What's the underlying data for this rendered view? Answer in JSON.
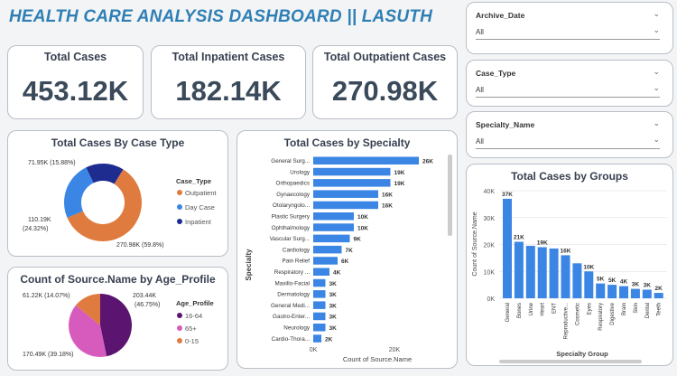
{
  "title": "HEALTH CARE ANALYSIS DASHBOARD || LASUTH",
  "kpis": [
    {
      "label": "Total Cases",
      "value": "453.12K"
    },
    {
      "label": "Total Inpatient Cases",
      "value": "182.14K"
    },
    {
      "label": "Total Outpatient Cases",
      "value": "270.98K"
    }
  ],
  "slicers": [
    {
      "label": "Archive_Date",
      "value": "All"
    },
    {
      "label": "Case_Type",
      "value": "All"
    },
    {
      "label": "Specialty_Name",
      "value": "All"
    }
  ],
  "colors": {
    "accent": "#2f7fb5",
    "bar": "#3b86e4",
    "outpatient": "#e07b3f",
    "daycase": "#3b86e4",
    "inpatient": "#1e2b8f",
    "age_16_64": "#5b1470",
    "age_65": "#d65bbd",
    "age_0_15": "#e07b3f"
  },
  "chart_data": [
    {
      "type": "pie",
      "variant": "donut",
      "title": "Total Cases By Case Type",
      "legend_title": "Case_Type",
      "legend_position": "right",
      "slices": [
        {
          "name": "Outpatient",
          "value": 270.98,
          "label": "270.98K (59.8%)"
        },
        {
          "name": "Day Case",
          "value": 110.19,
          "label": "110.19K (24.32%)"
        },
        {
          "name": "Inpatient",
          "value": 71.95,
          "label": "71.95K (15.88%)"
        }
      ]
    },
    {
      "type": "bar",
      "orientation": "horizontal",
      "title": "Total Cases by Specialty",
      "xlabel": "Count of Source.Name",
      "ylabel": "Specialty",
      "xlim": [
        0,
        30000
      ],
      "ticks": [
        "0K",
        "20K"
      ],
      "categories": [
        "General Surg...",
        "Urology",
        "Orthopaedics",
        "Gynaecology",
        "Otolaryngolo...",
        "Plastic Surgery",
        "Ophthalmology",
        "Vascular Surg...",
        "Cardiology",
        "Pain Relief",
        "Respiratory ...",
        "Maxillo-Facial",
        "Dermatology",
        "General Medi...",
        "Gastro-Enter...",
        "Neurology",
        "Cardio-Thora..."
      ],
      "values": [
        26000,
        19000,
        19000,
        16000,
        16000,
        10000,
        10000,
        9000,
        7000,
        6000,
        4000,
        3000,
        3000,
        3000,
        3000,
        3000,
        2000
      ],
      "labels": [
        "26K",
        "19K",
        "19K",
        "16K",
        "16K",
        "10K",
        "10K",
        "9K",
        "7K",
        "6K",
        "4K",
        "3K",
        "3K",
        "3K",
        "3K",
        "3K",
        "2K"
      ]
    },
    {
      "type": "pie",
      "title": "Count of Source.Name by Age_Profile",
      "legend_title": "Age_Profile",
      "legend_position": "right",
      "slices": [
        {
          "name": "16-64",
          "value": 203.44,
          "label": "203.44K (46.75%)"
        },
        {
          "name": "65+",
          "value": 170.49,
          "label": "170.49K (39.18%)"
        },
        {
          "name": "0-15",
          "value": 61.22,
          "label": "61.22K (14.07%)"
        }
      ]
    },
    {
      "type": "bar",
      "title": "Total Cases by Groups",
      "xlabel": "Specialty Group",
      "ylabel": "Count of Source.Name",
      "ylim": [
        0,
        40000
      ],
      "yticks": [
        "0K",
        "10K",
        "20K",
        "30K",
        "40K"
      ],
      "categories": [
        "General",
        "Bones",
        "Urine",
        "Heart",
        "ENT",
        "Reproductive...",
        "Cosmetic",
        "Eyes",
        "Respiratory",
        "Digestive",
        "Brain",
        "Skin",
        "Dental",
        "Teeth"
      ],
      "values": [
        37000,
        21000,
        19500,
        19000,
        18500,
        16000,
        13000,
        10000,
        5500,
        5000,
        4500,
        3500,
        3200,
        2000
      ],
      "labels": [
        "37K",
        "21K",
        "",
        "19K",
        "",
        "16K",
        "",
        "10K",
        "5K",
        "5K",
        "4K",
        "3K",
        "3K",
        "2K"
      ]
    }
  ]
}
